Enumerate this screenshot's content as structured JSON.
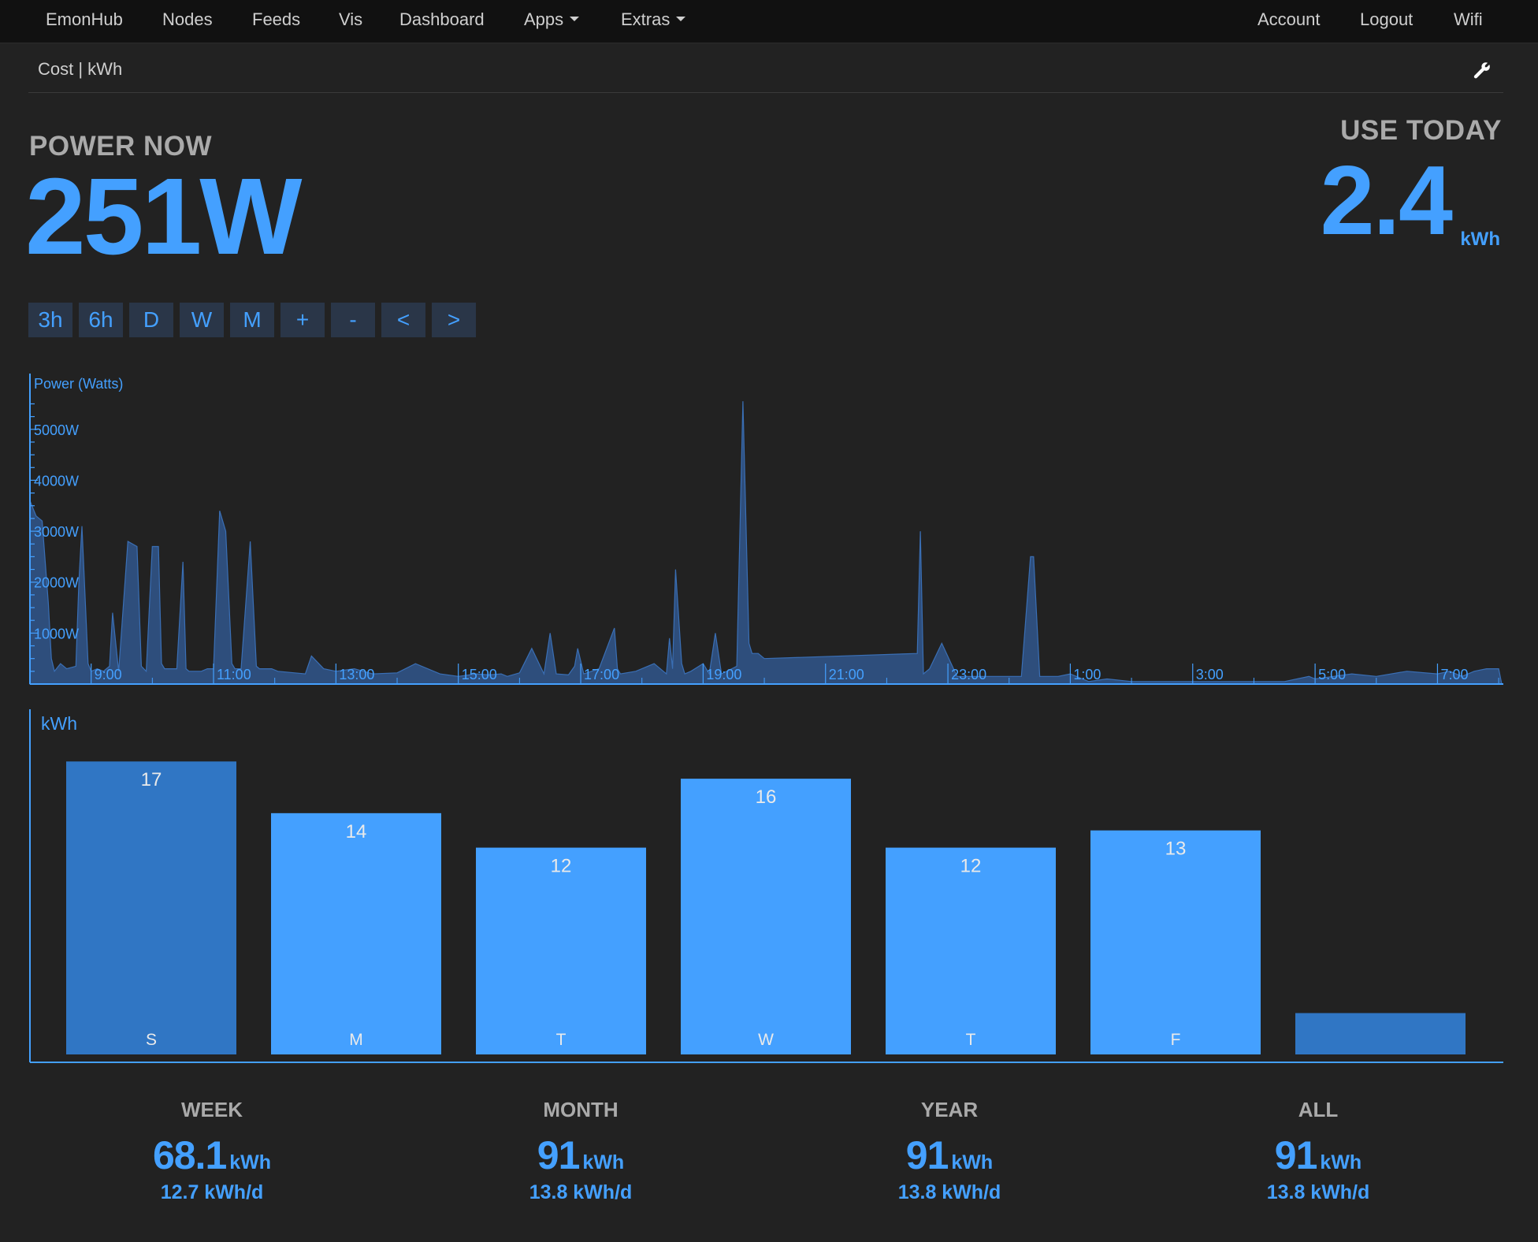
{
  "navbar": {
    "items": [
      {
        "label": "EmonHub",
        "dropdown": false
      },
      {
        "label": "Nodes",
        "dropdown": false
      },
      {
        "label": "Feeds",
        "dropdown": false
      },
      {
        "label": "Vis",
        "dropdown": false
      },
      {
        "label": "Dashboard",
        "dropdown": false
      },
      {
        "label": "Apps",
        "dropdown": true
      },
      {
        "label": "Extras",
        "dropdown": true
      }
    ],
    "right_items": [
      {
        "label": "Account"
      },
      {
        "label": "Logout"
      },
      {
        "label": "Wifi"
      }
    ]
  },
  "header": {
    "title": "Cost | kWh",
    "settings_icon": "wrench-icon"
  },
  "power_now": {
    "label": "POWER NOW",
    "value": "251W"
  },
  "use_today": {
    "label": "USE TODAY",
    "value": "2.4",
    "unit": "kWh"
  },
  "time_buttons": [
    "3h",
    "6h",
    "D",
    "W",
    "M",
    "+",
    "-",
    "<",
    ">"
  ],
  "colors": {
    "accent": "#44a0ff",
    "bar_highlight": "#3076c4",
    "area_fill": "#2e4e7c",
    "background": "#222222",
    "navbar": "#111111"
  },
  "chart_data": [
    {
      "type": "area",
      "ylabel": "Power (Watts)",
      "y_ticks": [
        "5000W",
        "4000W",
        "3000W",
        "2000W",
        "1000W"
      ],
      "y_tick_values": [
        5000,
        4000,
        3000,
        2000,
        1000
      ],
      "ylim": [
        0,
        5600
      ],
      "x_ticks": [
        "9:00",
        "11:00",
        "13:00",
        "15:00",
        "17:00",
        "19:00",
        "21:00",
        "23:00",
        "1:00",
        "3:00",
        "5:00",
        "7:00"
      ],
      "x_tick_hours": [
        9,
        11,
        13,
        15,
        17,
        19,
        21,
        23,
        25,
        27,
        29,
        31
      ],
      "xlim_hours": [
        8.0,
        32.05
      ],
      "series": [
        {
          "x_hours": [
            8.0,
            8.1,
            8.2,
            8.3,
            8.35,
            8.4,
            8.5,
            8.6,
            8.75,
            8.8,
            8.85,
            8.95,
            9.0,
            9.1,
            9.2,
            9.3,
            9.35,
            9.45,
            9.6,
            9.75,
            9.82,
            9.9,
            10.0,
            10.1,
            10.15,
            10.2,
            10.4,
            10.5,
            10.55,
            10.6,
            10.8,
            10.9,
            11.0,
            11.1,
            11.2,
            11.3,
            11.35,
            11.45,
            11.6,
            11.7,
            11.75,
            11.82,
            11.95,
            12.05,
            12.5,
            12.6,
            12.8,
            13.0,
            13.3,
            13.6,
            14.0,
            14.3,
            14.7,
            15.0,
            15.3,
            15.5,
            15.7,
            15.8,
            16.0,
            16.2,
            16.4,
            16.5,
            16.6,
            16.8,
            16.9,
            16.95,
            17.05,
            17.3,
            17.55,
            17.6,
            17.65,
            17.9,
            18.2,
            18.4,
            18.45,
            18.5,
            18.55,
            18.65,
            18.7,
            18.8,
            19.0,
            19.1,
            19.2,
            19.3,
            19.55,
            19.65,
            19.75,
            19.8,
            19.9,
            20.0,
            22.5,
            22.55,
            22.6,
            22.7,
            22.9,
            23.15,
            23.5,
            23.8,
            24.0,
            24.2,
            24.35,
            24.4,
            24.5,
            24.6,
            24.8,
            25.0,
            25.3,
            25.6,
            26.0,
            26.5,
            27.0,
            27.5,
            28.0,
            28.5,
            28.9,
            29.0,
            29.3,
            29.6,
            30.0,
            30.5,
            31.0,
            31.2,
            31.4,
            31.6,
            31.8,
            32.0,
            32.05
          ],
          "y_watts": [
            3600,
            3300,
            3200,
            1600,
            500,
            250,
            400,
            300,
            350,
            2000,
            3100,
            400,
            250,
            300,
            250,
            350,
            1400,
            250,
            2800,
            2700,
            350,
            250,
            2700,
            2700,
            400,
            300,
            300,
            2400,
            300,
            250,
            250,
            300,
            300,
            3400,
            3000,
            400,
            300,
            300,
            2800,
            350,
            300,
            300,
            300,
            250,
            200,
            550,
            300,
            250,
            300,
            200,
            220,
            400,
            200,
            150,
            200,
            180,
            200,
            150,
            220,
            700,
            200,
            1000,
            200,
            180,
            350,
            700,
            200,
            300,
            1100,
            300,
            200,
            250,
            400,
            200,
            900,
            300,
            2250,
            400,
            200,
            250,
            400,
            200,
            1000,
            200,
            350,
            5550,
            800,
            600,
            600,
            500,
            600,
            3000,
            200,
            300,
            800,
            150,
            150,
            150,
            150,
            150,
            2500,
            2500,
            150,
            150,
            150,
            200,
            50,
            100,
            50,
            50,
            50,
            50,
            50,
            50,
            150,
            100,
            150,
            200,
            150,
            250,
            200,
            250,
            150,
            250,
            300,
            300,
            0
          ]
        }
      ]
    },
    {
      "type": "bar",
      "ylabel": "kWh",
      "categories": [
        "S",
        "M",
        "T",
        "W",
        "T",
        "F",
        ""
      ],
      "values": [
        17,
        14,
        12,
        16,
        12,
        13,
        2.4
      ],
      "value_labels": [
        "17",
        "14",
        "12",
        "16",
        "12",
        "13",
        ""
      ],
      "highlight": [
        true,
        false,
        false,
        false,
        false,
        false,
        true
      ],
      "ylim": [
        0,
        18.2
      ]
    }
  ],
  "totals": [
    {
      "label": "WEEK",
      "value": "68.1",
      "unit": "kWh",
      "rate": "12.7 kWh/d"
    },
    {
      "label": "MONTH",
      "value": "91",
      "unit": "kWh",
      "rate": "13.8 kWh/d"
    },
    {
      "label": "YEAR",
      "value": "91",
      "unit": "kWh",
      "rate": "13.8 kWh/d"
    },
    {
      "label": "ALL",
      "value": "91",
      "unit": "kWh",
      "rate": "13.8 kWh/d"
    }
  ]
}
